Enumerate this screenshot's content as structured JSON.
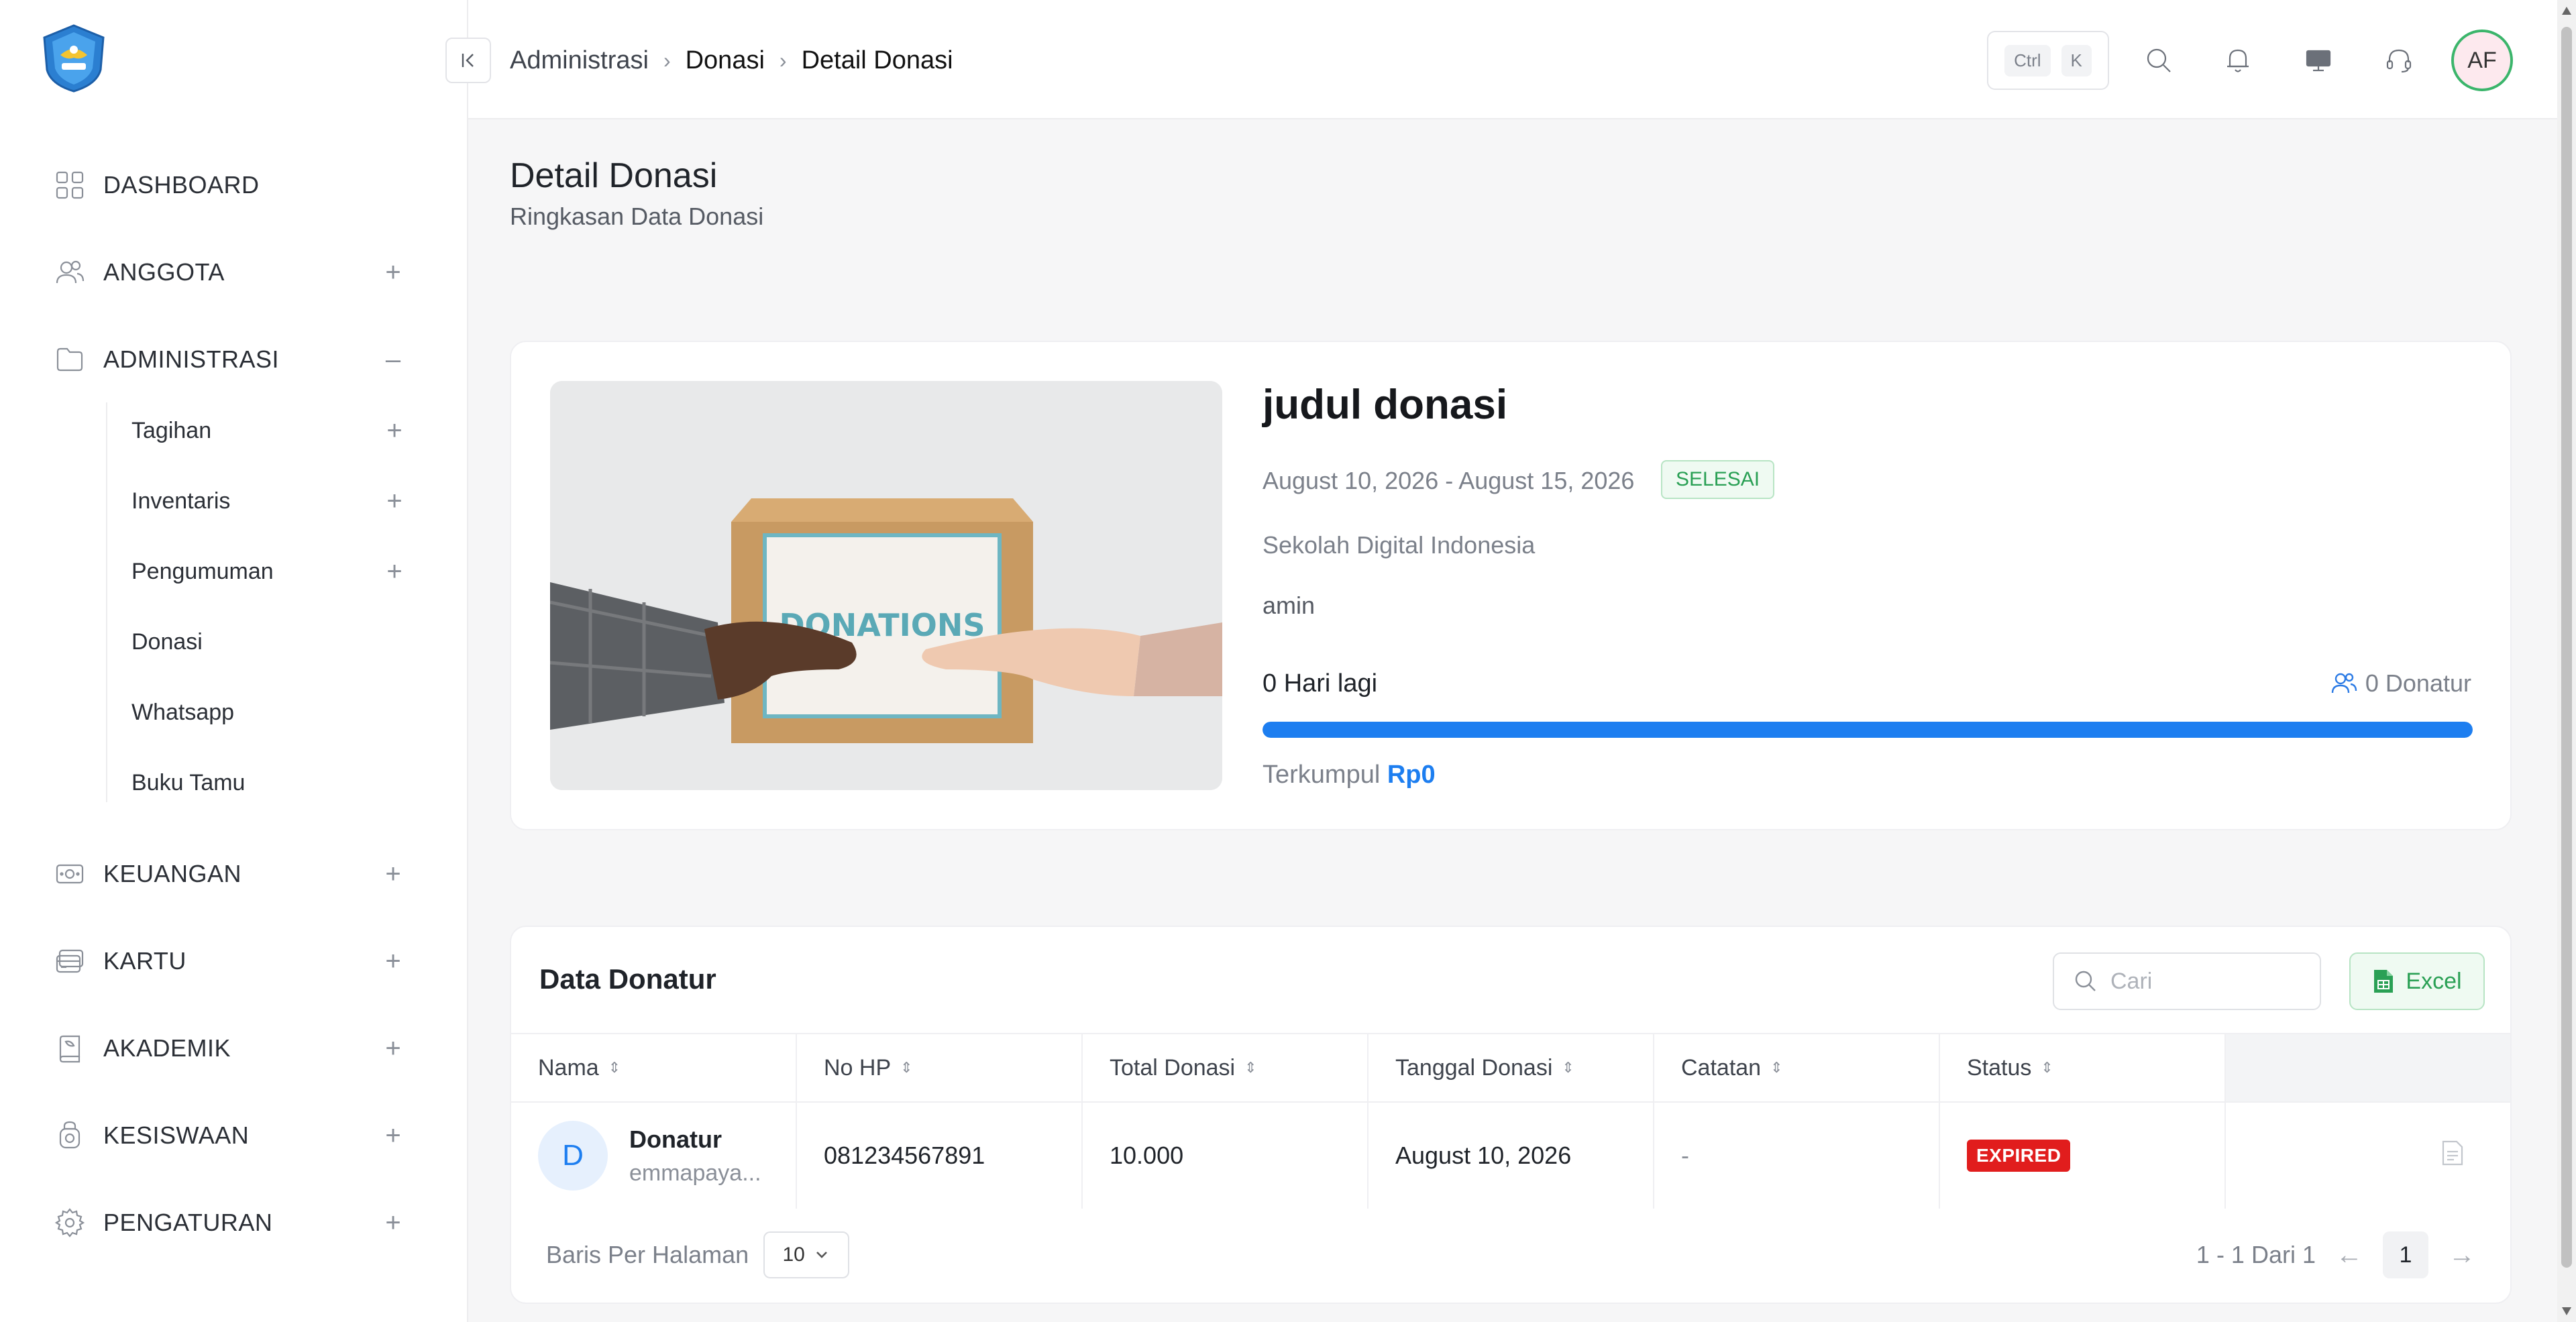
{
  "sidebar": {
    "items": [
      {
        "label": "DASHBOARD",
        "icon": "grid-icon"
      },
      {
        "label": "ANGGOTA",
        "icon": "users-icon"
      },
      {
        "label": "ADMINISTRASI",
        "icon": "folder-icon"
      },
      {
        "label": "KEUANGAN",
        "icon": "money-icon"
      },
      {
        "label": "KARTU",
        "icon": "card-icon"
      },
      {
        "label": "AKADEMIK",
        "icon": "book-icon"
      },
      {
        "label": "KESISWAAN",
        "icon": "student-icon"
      },
      {
        "label": "PENGATURAN",
        "icon": "gear-icon"
      }
    ],
    "administrasi_sub": [
      {
        "label": "Tagihan"
      },
      {
        "label": "Inventaris"
      },
      {
        "label": "Pengumuman"
      },
      {
        "label": "Donasi"
      },
      {
        "label": "Whatsapp"
      },
      {
        "label": "Buku Tamu"
      }
    ],
    "plus": "+",
    "minus": "–"
  },
  "topbar": {
    "breadcrumb": [
      "Administrasi",
      "Donasi",
      "Detail Donasi"
    ],
    "kbd_ctrl": "Ctrl",
    "kbd_k": "K",
    "avatar": "AF"
  },
  "page": {
    "title": "Detail Donasi",
    "subtitle": "Ringkasan Data Donasi"
  },
  "donation": {
    "image_text": "DONATIONS",
    "title": "judul donasi",
    "dates": "August 10, 2026 - August 15, 2026",
    "status": "SELESAI",
    "school": "Sekolah Digital Indonesia",
    "description": "amin",
    "days_left": "0 Hari lagi",
    "donors": "0 Donatur",
    "progress_fraction": 1.0,
    "collected_label": "Terkumpul",
    "collected_amount": "Rp0"
  },
  "donors_table": {
    "title": "Data Donatur",
    "search_placeholder": "Cari",
    "excel_label": "Excel",
    "columns": [
      "Nama",
      "No HP",
      "Total Donasi",
      "Tanggal Donasi",
      "Catatan",
      "Status"
    ],
    "rows": [
      {
        "initial": "D",
        "name": "Donatur",
        "email": "emmapaya...",
        "phone": "081234567891",
        "total": "10.000",
        "date": "August 10, 2026",
        "note": "-",
        "status": "EXPIRED"
      }
    ],
    "rows_per_page_label": "Baris Per Halaman",
    "rows_per_page": "10",
    "pagination_info": "1 - 1 Dari 1",
    "current_page": "1"
  },
  "colors": {
    "accent": "#1d7ef0",
    "success": "#2aa055",
    "danger": "#e11d1d"
  }
}
